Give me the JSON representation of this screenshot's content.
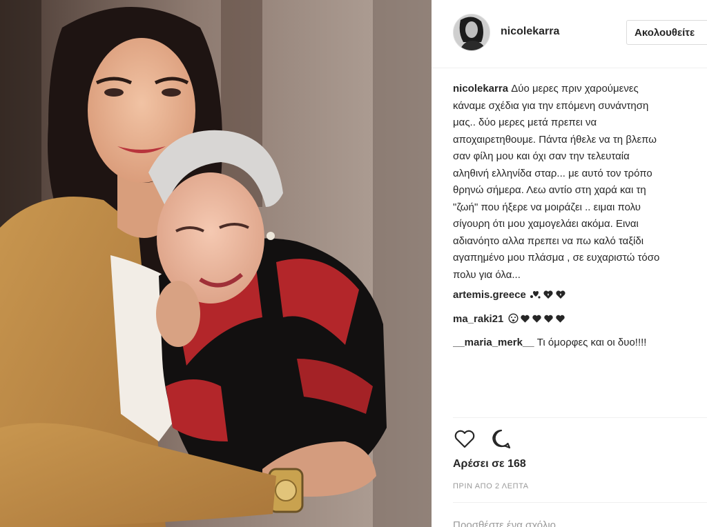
{
  "post": {
    "username": "nicolekarra",
    "follow_label": "Ακολουθείτε",
    "caption_lines": [
      "Δύο μερες πριν χαρούμενες",
      "κάναμε σχέδια για την επόμενη συνάντηση",
      "μας.. δύο μερες μετά πρεπει να",
      "αποχαιρετηθουμε. Πάντα ήθελε να τη βλεπω",
      "σαν φίλη μου και όχι σαν την τελευταία",
      "αληθινή ελληνίδα σταρ... με αυτό τον τρόπο",
      "θρηνώ σήμερα. Λεω αντίο στη χαρά και τη",
      "\"ζωή\" που ήξερε να μοιράζει .. ειμαι πολυ",
      "σίγουρη ότι μου χαμογελάει ακόμα. Ειναι",
      "αδιανόητο αλλα πρεπει να πω καλό ταξίδι",
      "αγαπημένο μου πλάσμα , σε ευχαριστώ τόσο",
      "πολυ για όλα..."
    ],
    "comments": [
      {
        "username": "artemis.greece",
        "text": "",
        "emoji": [
          "heart-cluster",
          "heart-sparkle",
          "heart-sparkle"
        ]
      },
      {
        "username": "ma_raki21",
        "text": "",
        "emoji": [
          "crying-face",
          "black-heart",
          "black-heart",
          "black-heart",
          "black-heart"
        ]
      },
      {
        "username": "__maria_merk__",
        "text": "Τι όμορφες και οι δυο!!!!",
        "emoji": []
      }
    ],
    "actions": {
      "like_icon": "heart-outline-icon",
      "comment_icon": "comment-bubble-icon"
    },
    "likes_label": "Αρέσει σε 168",
    "timestamp": "ΠΡΙΝ ΑΠΟ 2 ΛΕΠΤΑ",
    "add_comment_placeholder": "Προσθέστε ένα σχόλιο..."
  },
  "colors": {
    "text": "#262626",
    "muted": "#999999",
    "border": "#dbdbdb",
    "separator": "#efefef"
  }
}
